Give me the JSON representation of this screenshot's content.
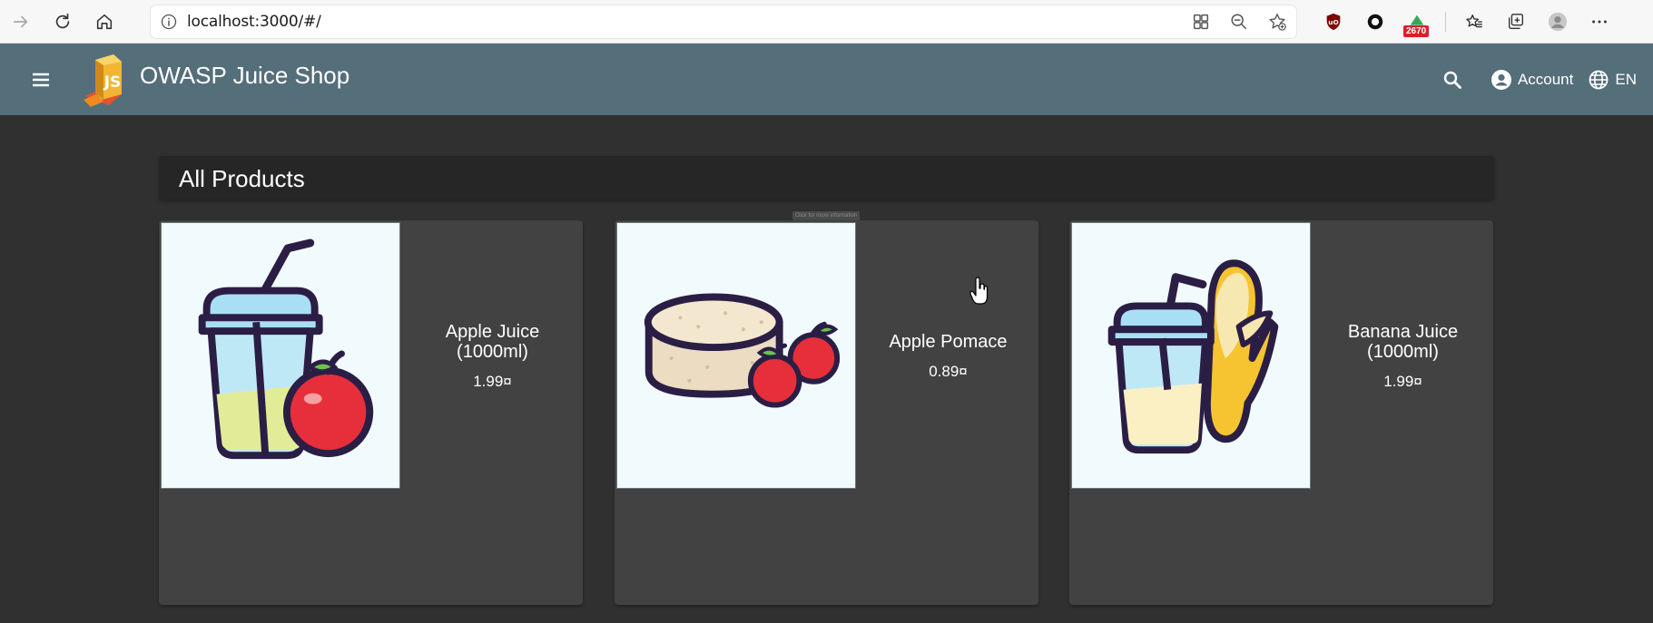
{
  "browser": {
    "url": "localhost:3000/#/",
    "extension_badge": "2670"
  },
  "app": {
    "title": "OWASP Juice Shop",
    "account_label": "Account",
    "language_label": "EN",
    "toolbar_color": "#546e7a"
  },
  "main": {
    "section_title": "All Products",
    "products": [
      {
        "name": "Apple Juice (1000ml)",
        "price": "1.99¤",
        "icon": "apple-juice-cup-icon"
      },
      {
        "name": "Apple Pomace",
        "price": "0.89¤",
        "icon": "apple-pomace-icon"
      },
      {
        "name": "Banana Juice (1000ml)",
        "price": "1.99¤",
        "icon": "banana-juice-cup-icon"
      }
    ],
    "hint_text": "Click for more information"
  }
}
